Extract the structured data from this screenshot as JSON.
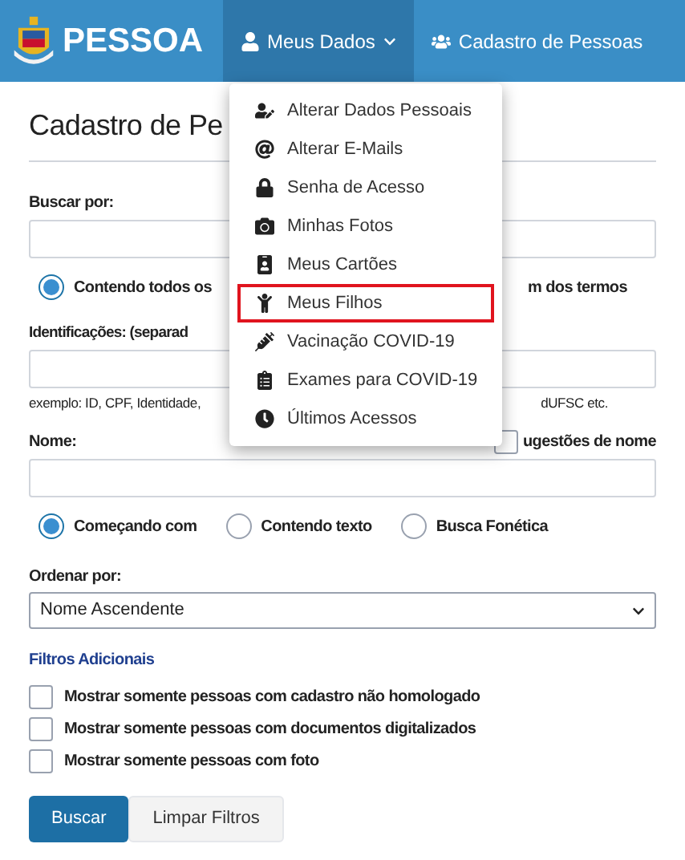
{
  "navbar": {
    "brand": "PESSOA",
    "items": [
      {
        "label": "Meus Dados",
        "kind": "dropdown",
        "selected": true
      },
      {
        "label": "Cadastro de Pessoas",
        "kind": "link",
        "selected": false
      }
    ]
  },
  "dropdown": {
    "items": [
      {
        "label": "Alterar Dados Pessoais",
        "selected": false
      },
      {
        "label": "Alterar E-Mails",
        "selected": false
      },
      {
        "label": "Senha de Acesso",
        "selected": false
      },
      {
        "label": "Minhas Fotos",
        "selected": false
      },
      {
        "label": "Meus Cartões",
        "selected": false
      },
      {
        "label": "Meus Filhos",
        "selected": true
      },
      {
        "label": "Vacinação COVID-19",
        "selected": false
      },
      {
        "label": "Exames para COVID-19",
        "selected": false
      },
      {
        "label": "Últimos Acessos",
        "selected": false
      }
    ]
  },
  "page": {
    "title": "Cadastro de Pe",
    "buscar": {
      "label": "Buscar por:",
      "options": [
        {
          "label": "Contendo todos os",
          "selected": true
        }
      ],
      "option_tail": "m dos termos"
    },
    "identificacoes": {
      "label": "Identificações: (separad",
      "hint_left": "exemplo: ID, CPF, Identidade,",
      "hint_right": "dUFSC etc."
    },
    "nome": {
      "label": "Nome:",
      "suggestions": {
        "label": "ugestões de nome",
        "checked": false
      },
      "options": [
        {
          "label": "Começando com",
          "selected": true
        },
        {
          "label": "Contendo texto",
          "selected": false
        },
        {
          "label": "Busca Fonética",
          "selected": false
        }
      ]
    },
    "ordenar": {
      "label": "Ordenar por:",
      "value": "Nome Ascendente"
    },
    "filtros": {
      "title": "Filtros Adicionais",
      "items": [
        {
          "label": "Mostrar somente pessoas com cadastro não homologado",
          "checked": false
        },
        {
          "label": "Mostrar somente pessoas com documentos digitalizados",
          "checked": false
        },
        {
          "label": "Mostrar somente pessoas com foto",
          "checked": false
        }
      ]
    },
    "buttons": [
      {
        "label": "Buscar",
        "kind": "primary"
      },
      {
        "label": "Limpar Filtros",
        "kind": "secondary"
      }
    ]
  }
}
